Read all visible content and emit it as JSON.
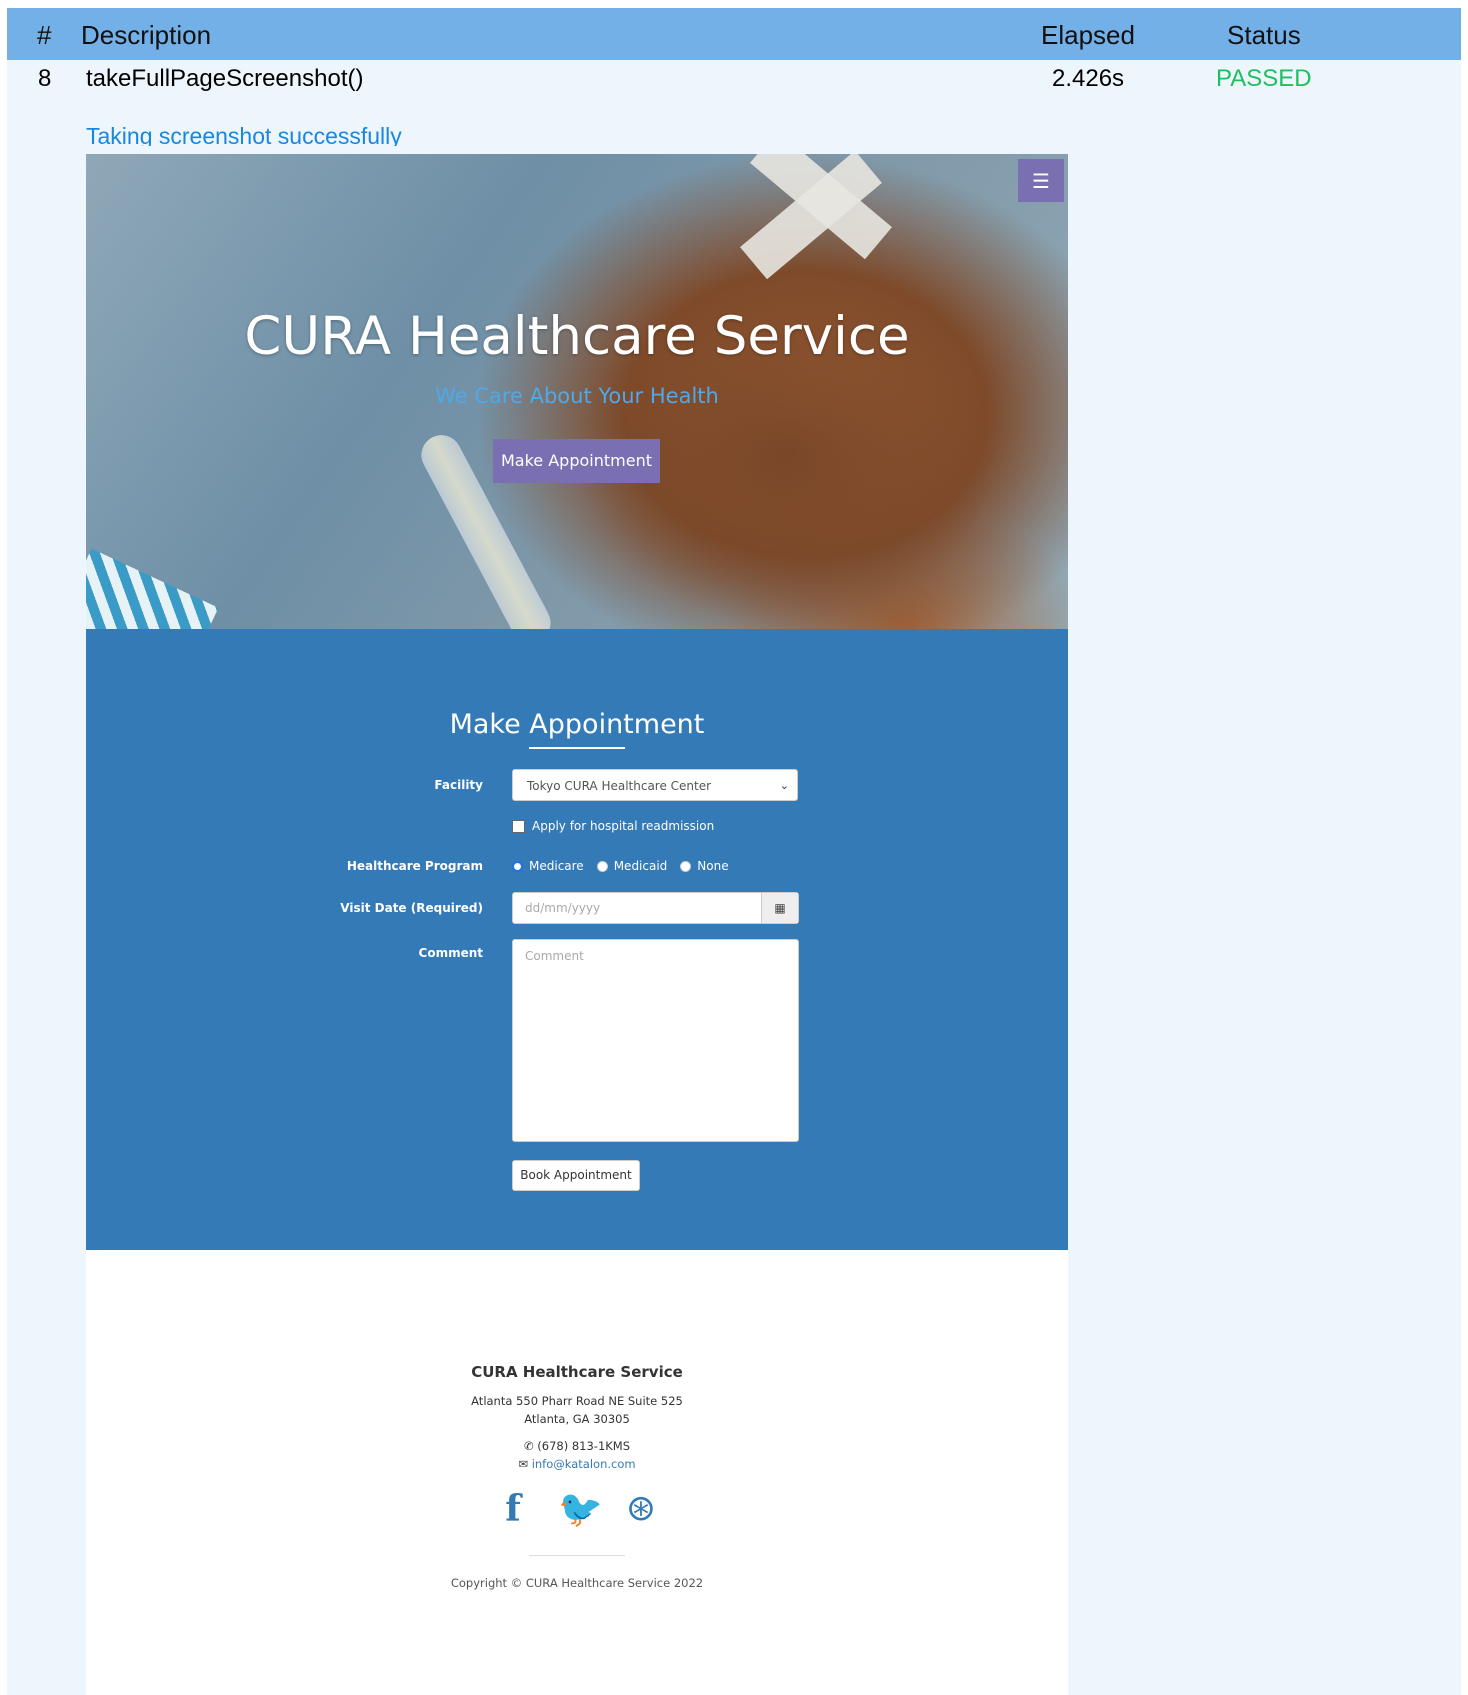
{
  "report": {
    "columns": [
      "#",
      "Description",
      "Elapsed",
      "Status"
    ],
    "row": {
      "index": "8",
      "description": "takeFullPageScreenshot()",
      "elapsed": "2.426s",
      "status": "PASSED"
    },
    "message": "Taking screenshot successfully"
  },
  "site": {
    "menu_icon": "hamburger-icon",
    "hero": {
      "title": "CURA Healthcare Service",
      "subtitle": "We Care About Your Health",
      "button": "Make Appointment"
    },
    "appointment": {
      "title": "Make Appointment",
      "facility_label": "Facility",
      "facility_value": "Tokyo CURA Healthcare Center",
      "readmission_label": "Apply for hospital readmission",
      "program_label": "Healthcare Program",
      "programs": [
        "Medicare",
        "Medicaid",
        "None"
      ],
      "selected_program": "Medicare",
      "visit_date_label": "Visit Date (Required)",
      "visit_date_placeholder": "dd/mm/yyyy",
      "comment_label": "Comment",
      "comment_placeholder": "Comment",
      "book_button": "Book Appointment"
    },
    "footer": {
      "title": "CURA Healthcare Service",
      "address_1": "Atlanta 550 Pharr Road NE Suite 525",
      "address_2": "Atlanta, GA 30305",
      "phone": "(678) 813-1KMS",
      "email": "info@katalon.com",
      "social_icons": [
        "facebook-icon",
        "twitter-icon",
        "dribbble-icon"
      ],
      "copyright": "Copyright © CURA Healthcare Service 2022"
    }
  },
  "colors": {
    "header_bg": "#73b0e8",
    "passed": "#1fbf5f",
    "link": "#1b86e0",
    "section_blue": "#337ab7",
    "accent_purple": "#7a6fb0"
  }
}
